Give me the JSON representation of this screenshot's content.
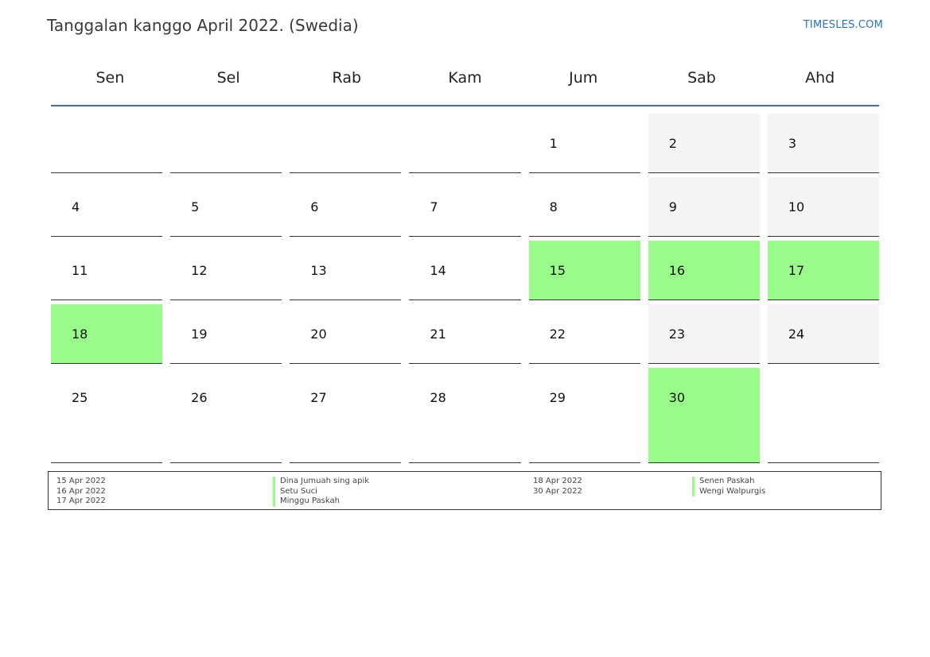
{
  "header": {
    "title": "Tanggalan kanggo April 2022. (Swedia)",
    "brand": "TIMESLES.COM"
  },
  "colors": {
    "holiday": "#99fb8a",
    "weekend": "#f4f4f4",
    "header_rule": "#4a6a8e",
    "brand": "#2a73b8"
  },
  "weekdays": [
    "Sen",
    "Sel",
    "Rab",
    "Kam",
    "Jum",
    "Sab",
    "Ahd"
  ],
  "weeks": [
    [
      {
        "day": "",
        "type": "empty"
      },
      {
        "day": "",
        "type": "empty"
      },
      {
        "day": "",
        "type": "empty"
      },
      {
        "day": "",
        "type": "empty"
      },
      {
        "day": "1",
        "type": "normal"
      },
      {
        "day": "2",
        "type": "weekend"
      },
      {
        "day": "3",
        "type": "weekend"
      }
    ],
    [
      {
        "day": "4",
        "type": "normal"
      },
      {
        "day": "5",
        "type": "normal"
      },
      {
        "day": "6",
        "type": "normal"
      },
      {
        "day": "7",
        "type": "normal"
      },
      {
        "day": "8",
        "type": "normal"
      },
      {
        "day": "9",
        "type": "weekend"
      },
      {
        "day": "10",
        "type": "weekend"
      }
    ],
    [
      {
        "day": "11",
        "type": "normal"
      },
      {
        "day": "12",
        "type": "normal"
      },
      {
        "day": "13",
        "type": "normal"
      },
      {
        "day": "14",
        "type": "normal"
      },
      {
        "day": "15",
        "type": "holiday"
      },
      {
        "day": "16",
        "type": "holiday"
      },
      {
        "day": "17",
        "type": "holiday"
      }
    ],
    [
      {
        "day": "18",
        "type": "holiday"
      },
      {
        "day": "19",
        "type": "normal"
      },
      {
        "day": "20",
        "type": "normal"
      },
      {
        "day": "21",
        "type": "normal"
      },
      {
        "day": "22",
        "type": "normal"
      },
      {
        "day": "23",
        "type": "weekend"
      },
      {
        "day": "24",
        "type": "weekend"
      }
    ],
    [
      {
        "day": "25",
        "type": "normal"
      },
      {
        "day": "26",
        "type": "normal"
      },
      {
        "day": "27",
        "type": "normal"
      },
      {
        "day": "28",
        "type": "normal"
      },
      {
        "day": "29",
        "type": "normal"
      },
      {
        "day": "30",
        "type": "holiday"
      },
      {
        "day": "",
        "type": "empty"
      }
    ]
  ],
  "legend": {
    "left": [
      {
        "date": "15 Apr 2022",
        "name": "Dina Jumuah sing apik"
      },
      {
        "date": "16 Apr 2022",
        "name": "Setu Suci"
      },
      {
        "date": "17 Apr 2022",
        "name": "Minggu Paskah"
      }
    ],
    "right": [
      {
        "date": "18 Apr 2022",
        "name": "Senen Paskah"
      },
      {
        "date": "30 Apr 2022",
        "name": "Wengi Walpurgis"
      }
    ]
  }
}
